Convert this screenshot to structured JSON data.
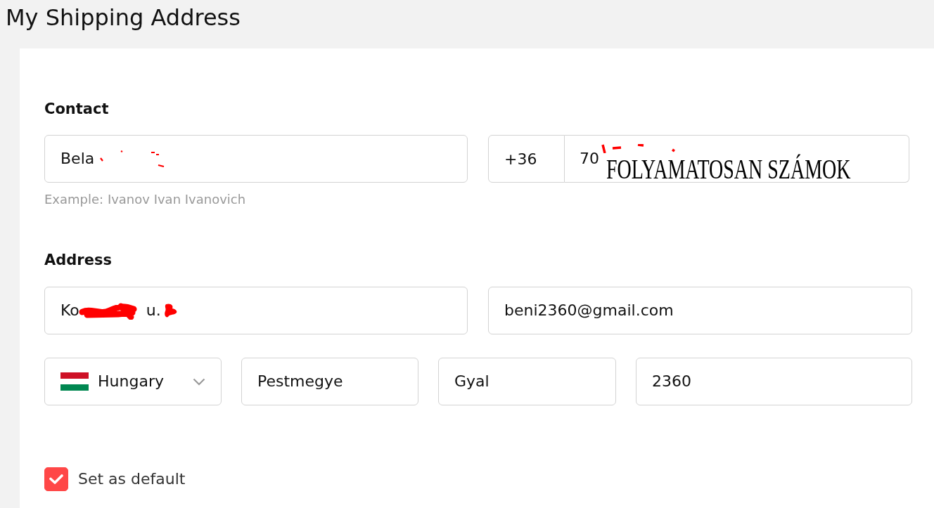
{
  "page_title": "My Shipping Address",
  "contact": {
    "heading": "Contact",
    "name_field": {
      "value_parts": [
        {
          "kind": "text",
          "text": "Bela"
        },
        {
          "kind": "specks"
        }
      ],
      "hint": "Example: Ivanov Ivan Ivanovich"
    },
    "phone_field": {
      "country_code": "+36",
      "value_parts": [
        {
          "kind": "text",
          "text": "70"
        },
        {
          "kind": "dashes"
        }
      ],
      "annotation": "FOLYAMATOSAN SZÁMOK"
    }
  },
  "address": {
    "heading": "Address",
    "street_field": {
      "value_parts": [
        {
          "kind": "text",
          "text": "Ko"
        },
        {
          "kind": "scribble"
        },
        {
          "kind": "text",
          "text": "u."
        },
        {
          "kind": "blot"
        }
      ]
    },
    "email_field": {
      "value": "beni2360@gmail.com"
    },
    "country_select": {
      "value": "Hungary"
    },
    "region_field": {
      "value": "Pestmegye"
    },
    "city_field": {
      "value": "Gyal"
    },
    "postal_code_field": {
      "value": "2360"
    }
  },
  "default_option": {
    "label": "Set as default",
    "checked": true
  }
}
